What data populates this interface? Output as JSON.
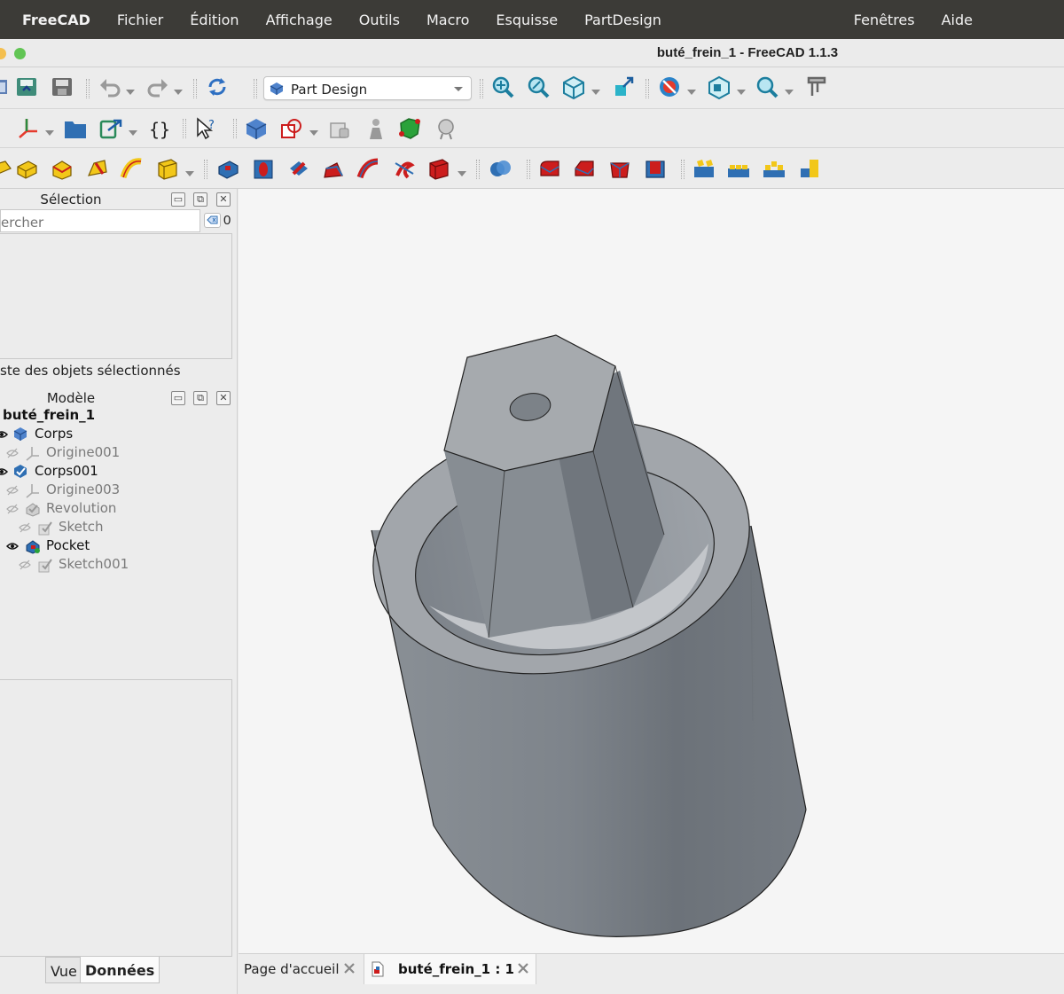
{
  "menubar": {
    "app_name": "FreeCAD",
    "items": [
      "Fichier",
      "Édition",
      "Affichage",
      "Outils",
      "Macro",
      "Esquisse",
      "PartDesign"
    ],
    "right_items": [
      "Fenêtres",
      "Aide"
    ]
  },
  "window": {
    "title": "buté_frein_1 - FreeCAD 1.1.3"
  },
  "toolbar": {
    "workbench": "Part Design",
    "icons_row1": [
      "open-icon",
      "save-icon",
      "undo-icon",
      "redo-icon",
      "refresh-icon",
      "workbench-selector",
      "fit-all-icon",
      "fit-selection-icon",
      "isometric-view-icon",
      "view-selection-icon",
      "draw-style-icon",
      "std-views-icon",
      "zoom-icon",
      "measure-icon"
    ],
    "icons_row2": [
      "axis-cross-icon",
      "folder-icon",
      "link-icon",
      "macro-braces-icon",
      "whats-this-icon",
      "body-icon",
      "shape-binder-icon",
      "clone-icon",
      "lock-icon",
      "sketch-icon",
      "tool-icon"
    ],
    "icons_row3": [
      "pad-icon",
      "revolution-icon",
      "loft-icon",
      "pipe-icon",
      "helix-icon",
      "additive-primitive-icon",
      "pocket-icon",
      "hole-icon",
      "groove-icon",
      "subtractive-loft-icon",
      "subtractive-pipe-icon",
      "subtractive-helix-icon",
      "subtractive-primitive-icon",
      "boolean-icon",
      "fillet-icon",
      "chamfer-icon",
      "draft-icon",
      "thickness-icon",
      "mirrored-icon",
      "linear-pattern-icon",
      "polar-pattern-icon",
      "multi-transform-icon"
    ]
  },
  "selection_panel": {
    "title": "Sélection",
    "search_placeholder": "ercher",
    "count": "0",
    "caption": "ste des objets sélectionnés"
  },
  "model_panel": {
    "title": "Modèle",
    "document": "buté_frein_1",
    "tree": [
      {
        "label": "Corps",
        "visible": true,
        "icon": "body-icon"
      },
      {
        "label": "Origine001",
        "visible": false,
        "icon": "origin-icon"
      },
      {
        "label": "Corps001",
        "visible": true,
        "icon": "body-active-icon"
      },
      {
        "label": "Origine003",
        "visible": false,
        "icon": "origin-icon"
      },
      {
        "label": "Revolution",
        "visible": false,
        "icon": "revolution-icon"
      },
      {
        "label": "Sketch",
        "visible": false,
        "icon": "sketch-icon"
      },
      {
        "label": "Pocket",
        "visible": true,
        "icon": "pocket-icon"
      },
      {
        "label": "Sketch001",
        "visible": false,
        "icon": "sketch-icon"
      }
    ]
  },
  "property_tabs": {
    "view": "Vue",
    "data": "Données",
    "active": "Données"
  },
  "document_tabs": [
    {
      "label": "Page d'accueil",
      "active": false
    },
    {
      "label": "buté_frein_1 : 1",
      "active": true
    }
  ],
  "colors": {
    "menubar_bg": "#3c3b37",
    "viewport_bg": "#f5f5f5",
    "model_gray": "#8a9096",
    "accent_blue": "#2f6fb3",
    "feature_red": "#cc1d1d",
    "feature_yellow": "#f2c719"
  }
}
